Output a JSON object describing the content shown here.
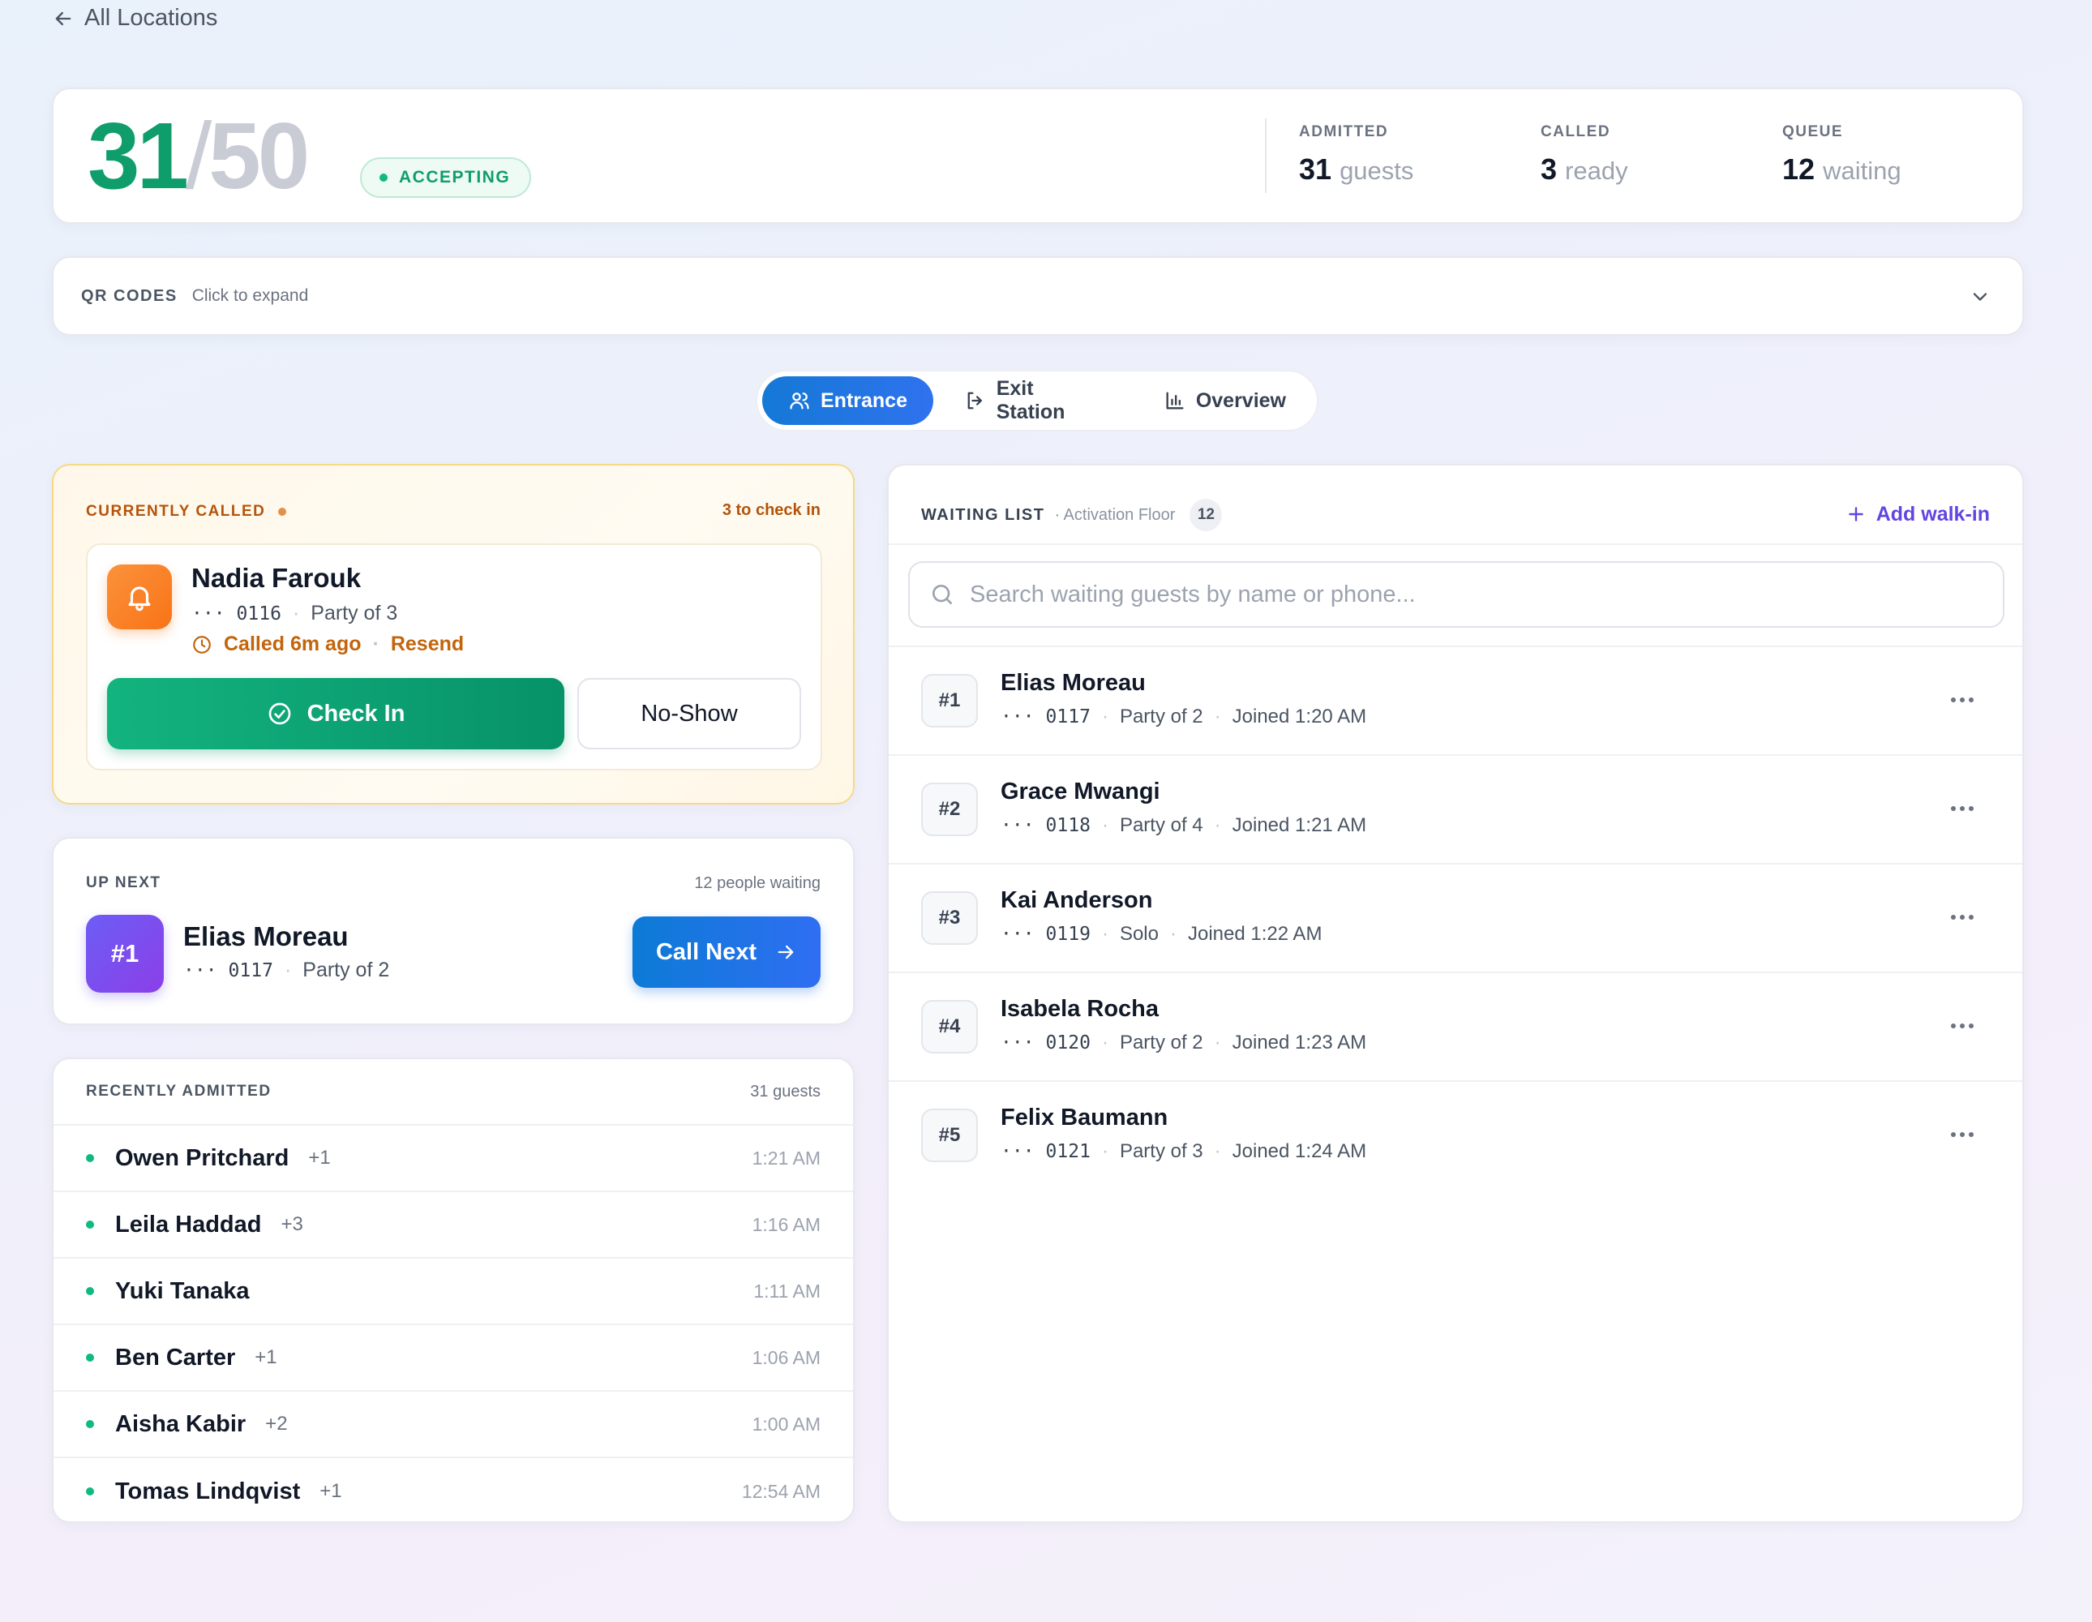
{
  "nav": {
    "back_label": "All Locations"
  },
  "capacity": {
    "current": "31",
    "slash": "/",
    "max": "50",
    "status": "ACCEPTING",
    "stats": [
      {
        "label": "ADMITTED",
        "value": "31",
        "unit": "guests"
      },
      {
        "label": "CALLED",
        "value": "3",
        "unit": "ready"
      },
      {
        "label": "QUEUE",
        "value": "12",
        "unit": "waiting"
      }
    ]
  },
  "qr": {
    "title": "QR CODES",
    "hint": "Click to expand"
  },
  "tabs": [
    {
      "label": "Entrance",
      "active": true
    },
    {
      "label": "Exit Station",
      "active": false
    },
    {
      "label": "Overview",
      "active": false
    }
  ],
  "called": {
    "title": "CURRENTLY CALLED",
    "right": "3 to check in",
    "guest": {
      "name": "Nadia Farouk",
      "phone_mask": "···",
      "phone": "0116",
      "party": "Party of 3",
      "called_ago": "Called 6m ago",
      "resend": "Resend"
    },
    "check_in_label": "Check In",
    "no_show_label": "No-Show"
  },
  "up_next": {
    "title": "UP NEXT",
    "right": "12 people waiting",
    "position": "#1",
    "name": "Elias Moreau",
    "phone_mask": "···",
    "phone": "0117",
    "party": "Party of 2",
    "call_next_label": "Call Next"
  },
  "recent": {
    "title": "RECENTLY ADMITTED",
    "right": "31 guests",
    "rows": [
      {
        "name": "Owen Pritchard",
        "plus": "+1",
        "time": "1:21 AM"
      },
      {
        "name": "Leila Haddad",
        "plus": "+3",
        "time": "1:16 AM"
      },
      {
        "name": "Yuki Tanaka",
        "plus": "",
        "time": "1:11 AM"
      },
      {
        "name": "Ben Carter",
        "plus": "+1",
        "time": "1:06 AM"
      },
      {
        "name": "Aisha Kabir",
        "plus": "+2",
        "time": "1:00 AM"
      },
      {
        "name": "Tomas Lindqvist",
        "plus": "+1",
        "time": "12:54 AM"
      }
    ]
  },
  "waiting": {
    "title": "WAITING LIST",
    "subtitle": "· Activation Floor",
    "count": "12",
    "add_label": "Add walk-in",
    "search_placeholder": "Search waiting guests by name or phone...",
    "rows": [
      {
        "pos": "#1",
        "name": "Elias Moreau",
        "mask": "···",
        "phone": "0117",
        "party": "Party of 2",
        "joined": "Joined 1:20 AM"
      },
      {
        "pos": "#2",
        "name": "Grace Mwangi",
        "mask": "···",
        "phone": "0118",
        "party": "Party of 4",
        "joined": "Joined 1:21 AM"
      },
      {
        "pos": "#3",
        "name": "Kai Anderson",
        "mask": "···",
        "phone": "0119",
        "party": "Solo",
        "joined": "Joined 1:22 AM"
      },
      {
        "pos": "#4",
        "name": "Isabela Rocha",
        "mask": "···",
        "phone": "0120",
        "party": "Party of 2",
        "joined": "Joined 1:23 AM"
      },
      {
        "pos": "#5",
        "name": "Felix Baumann",
        "mask": "···",
        "phone": "0121",
        "party": "Party of 3",
        "joined": "Joined 1:24 AM"
      }
    ]
  },
  "colors": {
    "accent_green": "#0f9d6b",
    "accent_blue": "#1479d6",
    "accent_orange": "#f97316",
    "accent_purple": "#6245e0"
  }
}
